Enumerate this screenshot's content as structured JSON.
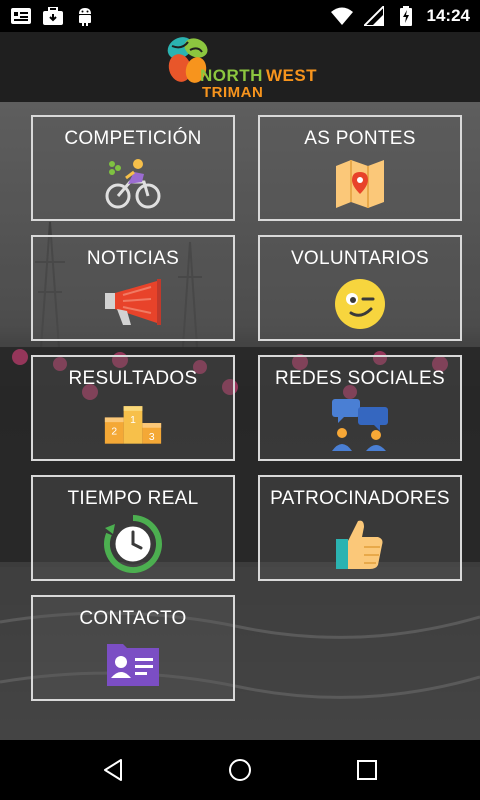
{
  "status_bar": {
    "time": "14:24",
    "left_icons": [
      "notification-card-icon",
      "briefcase-download-icon",
      "android-icon"
    ],
    "right_icons": [
      "wifi-icon",
      "signal-icon",
      "battery-charging-icon"
    ]
  },
  "header": {
    "logo_line1_part1": "NORTH",
    "logo_line1_part2": "WEST",
    "logo_line2": "TRIMAN"
  },
  "menu": [
    {
      "id": "competicion",
      "label": "COMPETICIÓN",
      "icon": "cyclist-icon"
    },
    {
      "id": "as-pontes",
      "label": "AS PONTES",
      "icon": "map-pin-icon"
    },
    {
      "id": "noticias",
      "label": "NOTICIAS",
      "icon": "megaphone-icon"
    },
    {
      "id": "voluntarios",
      "label": "VOLUNTARIOS",
      "icon": "wink-smiley-icon"
    },
    {
      "id": "resultados",
      "label": "RESULTADOS",
      "icon": "podium-icon"
    },
    {
      "id": "redes-sociales",
      "label": "REDES SOCIALES",
      "icon": "chat-people-icon"
    },
    {
      "id": "tiempo-real",
      "label": "TIEMPO REAL",
      "icon": "clock-icon"
    },
    {
      "id": "patrocinadores",
      "label": "PATROCINADORES",
      "icon": "thumbs-up-icon"
    },
    {
      "id": "contacto",
      "label": "CONTACTO",
      "icon": "contact-card-icon"
    }
  ],
  "podium_numbers": [
    "1",
    "2",
    "3"
  ],
  "colors": {
    "header_bg": "#1f1f1f",
    "tile_border": "#d9d9d9",
    "logo_green": "#8cc63f",
    "logo_orange": "#f7941d"
  },
  "nav_bar": {
    "buttons": [
      "back-triangle-icon",
      "home-circle-icon",
      "recents-square-icon"
    ]
  }
}
